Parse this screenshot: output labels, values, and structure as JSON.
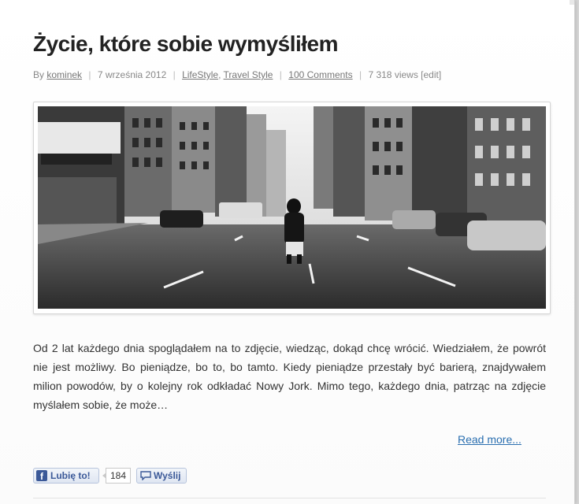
{
  "post": {
    "title": "Życie, które sobie wymyśliłem",
    "meta": {
      "by_label": "By",
      "author": "kominek",
      "date": "7 września 2012",
      "categories": [
        "LifeStyle",
        "Travel Style"
      ],
      "comments": "100 Comments",
      "views": "7 318 views",
      "edit": "[edit]"
    },
    "image_alt": "Black and white photo of a man standing in the middle of a New York street",
    "body": "Od 2 lat każdego dnia spoglądałem na to zdjęcie, wiedząc, dokąd chcę wrócić. Wiedziałem, że powrót nie jest możliwy. Bo pieniądze, bo to, bo tamto. Kiedy pieniądze przestały być barierą, znajdywałem milion powodów, by o kolejny rok odkładać Nowy Jork. Mimo tego, każdego dnia, patrząc na zdjęcie myślałem sobie, że może…",
    "read_more": "Read more..."
  },
  "social": {
    "like_label": "Lubię to!",
    "like_count": "184",
    "send_label": "Wyślij",
    "fb_letter": "f"
  },
  "colors": {
    "link": "#2a6fb0",
    "facebook": "#3b5998"
  }
}
